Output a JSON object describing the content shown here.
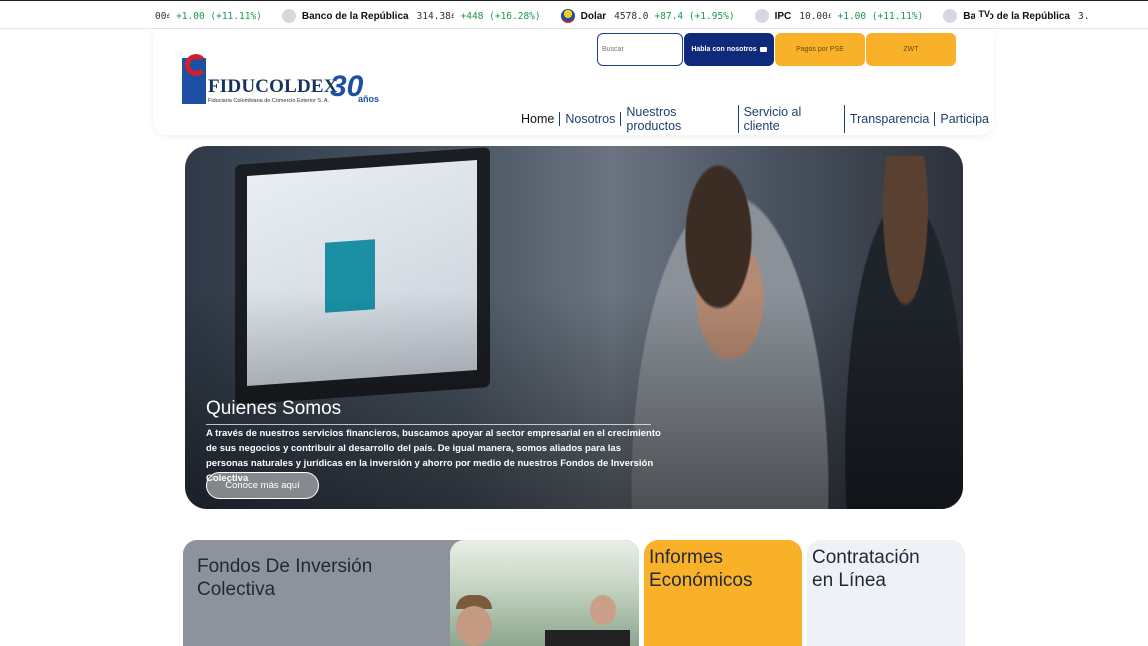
{
  "ticker": {
    "items": [
      {
        "name": "",
        "value": "00",
        "unit": "£",
        "change": "+1.00 (+11.11%)",
        "icon": "circle-icon"
      },
      {
        "name": "Banco de la República",
        "value": "314.38",
        "unit": "£",
        "change": "+448 (+16.28%)",
        "icon": "circle-icon"
      },
      {
        "name": "Dolar",
        "value": "4578.0",
        "unit": "",
        "change": "+87.4 (+1.95%)",
        "icon": "flag-icon"
      },
      {
        "name": "IPC",
        "value": "10.00",
        "unit": "£",
        "change": "+1.00 (+11.11%)",
        "icon": "circle-icon"
      },
      {
        "name": "Banco de la República",
        "value": "3.",
        "unit": "",
        "change": "",
        "icon": "circle-icon"
      }
    ],
    "badge": "TV"
  },
  "header": {
    "logo": {
      "name": "FIDUCOLDEX",
      "subtitle": "Fiduciaria Colombiana de Comercio Exterior S. A.",
      "anniversary_number": "30",
      "anniversary_word": "años"
    },
    "search_placeholder": "Buscar",
    "buttons": {
      "habla": "Habla con nosotros",
      "pagos": "Pagos por PSE",
      "zwt": "ZWT"
    },
    "nav": [
      "Home",
      "Nosotros",
      "Nuestros productos",
      "Servicio al cliente",
      "Transparencia",
      "Participa"
    ]
  },
  "hero": {
    "title": "Quienes Somos",
    "text": "A través de nuestros servicios financieros, buscamos apoyar al sector empresarial en el crecimiento de sus negocios y contribuir al desarrollo del país. De igual manera, somos aliados para las personas naturales y jurídicas en la inversión y ahorro por medio de nuestros Fondos de Inversión Colectiva",
    "button": "Conoce más aquí"
  },
  "cards": {
    "fondos": "Fondos De Inversión Colectiva",
    "informes": "Informes Económicos",
    "contratacion": "Contratación en Línea"
  },
  "colors": {
    "navy": "#0f2a7a",
    "gold": "#f9b12a",
    "gray_card": "#8e929c",
    "light_card": "#eef2f7"
  }
}
